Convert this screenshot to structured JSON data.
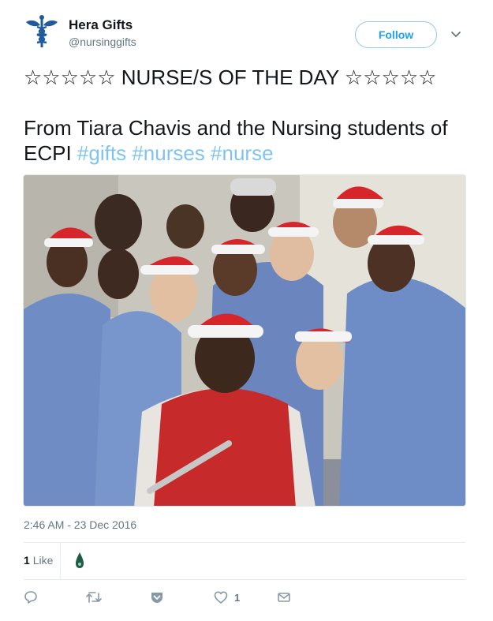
{
  "author": {
    "name": "Hera Gifts",
    "handle": "@nursinggifts",
    "avatar_icon": "caduceus-icon"
  },
  "header": {
    "follow_label": "Follow",
    "menu_icon": "chevron-down-icon"
  },
  "tweet": {
    "line1": "☆☆☆☆☆ NURSE/S OF THE DAY ☆☆☆☆☆",
    "body_text": "From Tiara Chavis and the Nursing students of ECPI",
    "hashtags": [
      "#gifts",
      "#nurses",
      "#nurse"
    ],
    "hashtag_color": "#7fc4f1"
  },
  "media": {
    "kind": "photo",
    "subject": "group-selfie"
  },
  "meta": {
    "timestamp": "2:46 AM - 23 Dec 2016",
    "like_count": "1",
    "like_word": "Like"
  },
  "actions": {
    "reply_icon": "reply-icon",
    "retweet_icon": "retweet-icon",
    "pocket_icon": "pocket-icon",
    "like_icon": "heart-icon",
    "like_count": "1",
    "dm_icon": "envelope-icon"
  },
  "colors": {
    "accent": "#1da1f2",
    "muted": "#657786",
    "text": "#14171a",
    "border": "#e6ecf0"
  }
}
